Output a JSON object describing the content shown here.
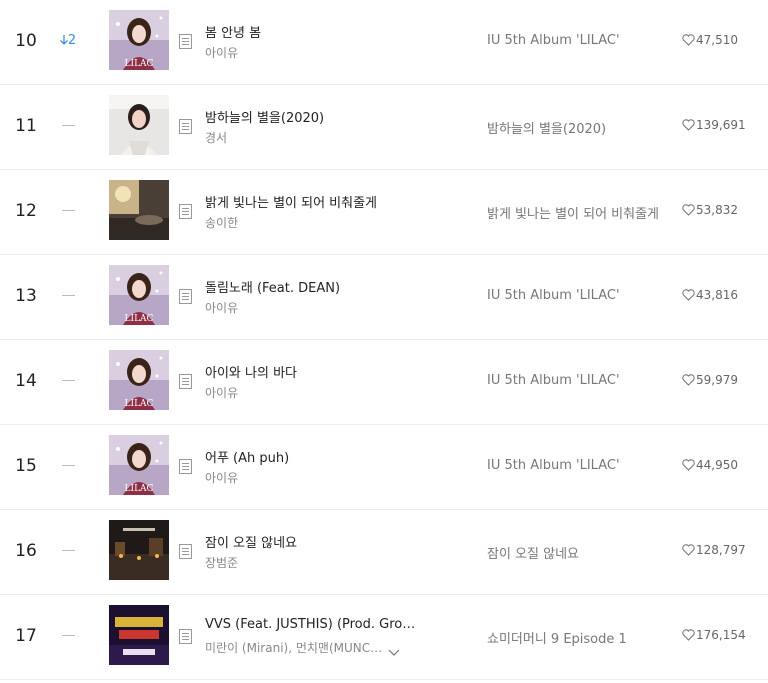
{
  "chart": {
    "rows": [
      {
        "rank": "10",
        "change": {
          "dir": "down",
          "amount": "2"
        },
        "cover": "lilac",
        "title": "봄 안녕 봄",
        "artist": "아이유",
        "album": "IU 5th Album 'LILAC'",
        "likes": "47,510",
        "more": false
      },
      {
        "rank": "11",
        "change": {
          "dir": "same",
          "amount": ""
        },
        "cover": "night",
        "title": "밤하늘의 별을(2020)",
        "artist": "경서",
        "album": "밤하늘의 별을(2020)",
        "likes": "139,691",
        "more": false
      },
      {
        "rank": "12",
        "change": {
          "dir": "same",
          "amount": ""
        },
        "cover": "room",
        "title": "밝게 빛나는 별이 되어 비춰줄게",
        "artist": "송이한",
        "album": "밝게 빛나는 별이 되어 비춰줄게",
        "likes": "53,832",
        "more": false
      },
      {
        "rank": "13",
        "change": {
          "dir": "same",
          "amount": ""
        },
        "cover": "lilac",
        "title": "돌림노래 (Feat. DEAN)",
        "artist": "아이유",
        "album": "IU 5th Album 'LILAC'",
        "likes": "43,816",
        "more": false
      },
      {
        "rank": "14",
        "change": {
          "dir": "same",
          "amount": ""
        },
        "cover": "lilac",
        "title": "아이와 나의 바다",
        "artist": "아이유",
        "album": "IU 5th Album 'LILAC'",
        "likes": "59,979",
        "more": false
      },
      {
        "rank": "15",
        "change": {
          "dir": "same",
          "amount": ""
        },
        "cover": "lilac",
        "title": "어푸 (Ah puh)",
        "artist": "아이유",
        "album": "IU 5th Album 'LILAC'",
        "likes": "44,950",
        "more": false
      },
      {
        "rank": "16",
        "change": {
          "dir": "same",
          "amount": ""
        },
        "cover": "street",
        "title": "잠이 오질 않네요",
        "artist": "장범준",
        "album": "잠이 오질 않네요",
        "likes": "128,797",
        "more": false
      },
      {
        "rank": "17",
        "change": {
          "dir": "same",
          "amount": ""
        },
        "cover": "smtm",
        "title": "VVS (Feat. JUSTHIS) (Prod. GroovyRoom)",
        "artist": "미란이 (Mirani), 먼치맨(MUNCHMAN)",
        "album": "쇼미더머니 9 Episode 1",
        "likes": "176,154",
        "more": true
      }
    ],
    "icons": {
      "info": "song-info-icon",
      "like": "heart-icon",
      "more": "chevron-down-icon",
      "down": "arrow-down-icon",
      "same": "no-change-dash-icon"
    },
    "colors": {
      "rank_down": "#3d8fe0",
      "divider": "#ececec",
      "artist": "#888888",
      "album": "#777777"
    }
  }
}
